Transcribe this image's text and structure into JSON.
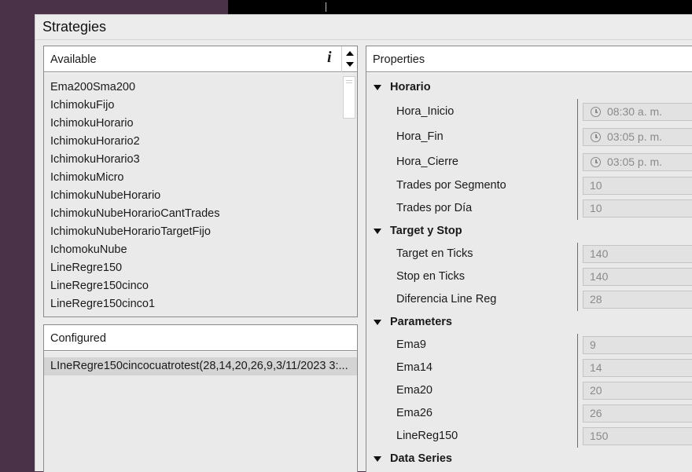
{
  "window": {
    "title": "Strategies"
  },
  "available": {
    "header": "Available",
    "info_glyph": "i",
    "items": [
      "Ema200Sma200",
      "IchimokuFijo",
      "IchimokuHorario",
      "IchimokuHorario2",
      "IchimokuHorario3",
      "IchimokuMicro",
      "IchimokuNubeHorario",
      "IchimokuNubeHorarioCantTrades",
      "IchimokuNubeHorarioTargetFijo",
      "IchomokuNube",
      "LineRegre150",
      "LineRegre150cinco",
      "LineRegre150cinco1"
    ]
  },
  "configured": {
    "header": "Configured",
    "items": [
      "LIneRegre150cincocuatrotest(28,14,20,26,9,3/11/2023 3:..."
    ]
  },
  "properties": {
    "header": "Properties",
    "categories": [
      {
        "label": "Horario",
        "props": [
          {
            "name": "Hora_Inicio",
            "value": "08:30 a. m.",
            "time": true
          },
          {
            "name": "Hora_Fin",
            "value": "03:05 p. m.",
            "time": true
          },
          {
            "name": "Hora_Cierre",
            "value": "03:05 p. m.",
            "time": true
          },
          {
            "name": "Trades por Segmento",
            "value": "10"
          },
          {
            "name": "Trades por Día",
            "value": "10"
          }
        ]
      },
      {
        "label": "Target y Stop",
        "props": [
          {
            "name": "Target en Ticks",
            "value": "140"
          },
          {
            "name": "Stop en Ticks",
            "value": "140"
          },
          {
            "name": "Diferencia Line Reg",
            "value": "28"
          }
        ]
      },
      {
        "label": "Parameters",
        "props": [
          {
            "name": "Ema9",
            "value": "9"
          },
          {
            "name": "Ema14",
            "value": "14"
          },
          {
            "name": "Ema20",
            "value": "20"
          },
          {
            "name": "Ema26",
            "value": "26"
          },
          {
            "name": "LineReg150",
            "value": "150"
          }
        ]
      },
      {
        "label": "Data Series",
        "props": []
      }
    ]
  }
}
